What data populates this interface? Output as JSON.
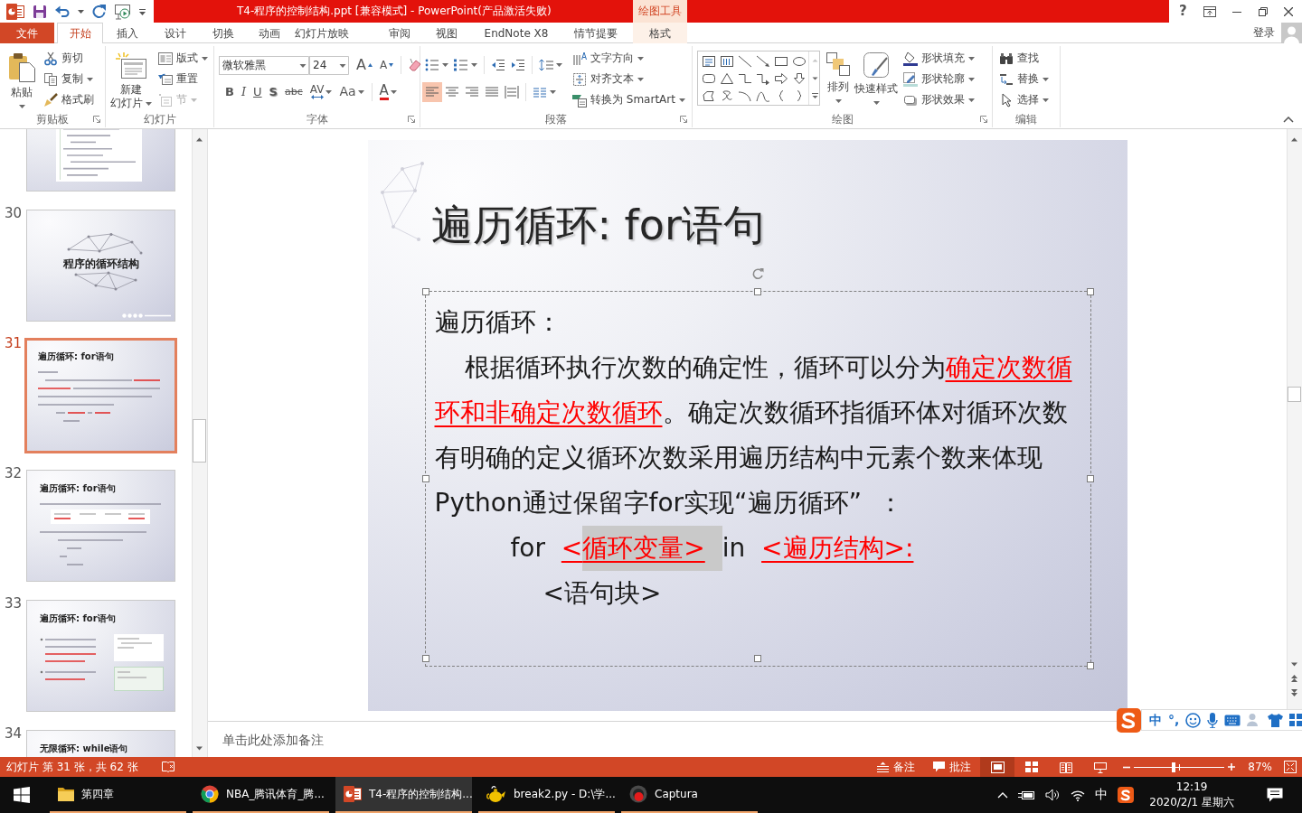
{
  "title_bar": {
    "title": "T4-程序的控制结构.ppt [兼容模式] - PowerPoint(产品激活失败)",
    "context_label": "绘图工具",
    "help": "?"
  },
  "tabs": [
    {
      "label": "文件",
      "kind": "file",
      "selected": false
    },
    {
      "label": "开始",
      "kind": "standard",
      "selected": true
    },
    {
      "label": "插入",
      "kind": "standard",
      "selected": false
    },
    {
      "label": "设计",
      "kind": "standard",
      "selected": false
    },
    {
      "label": "切换",
      "kind": "standard",
      "selected": false
    },
    {
      "label": "动画",
      "kind": "standard",
      "selected": false
    },
    {
      "label": "幻灯片放映",
      "kind": "standard",
      "selected": false
    },
    {
      "label": "审阅",
      "kind": "standard",
      "selected": false
    },
    {
      "label": "视图",
      "kind": "standard",
      "selected": false
    },
    {
      "label": "EndNote X8",
      "kind": "standard",
      "selected": false
    },
    {
      "label": "情节提要",
      "kind": "standard",
      "selected": false
    },
    {
      "label": "格式",
      "kind": "contextual",
      "selected": false
    }
  ],
  "account": {
    "sign_in": "登录"
  },
  "ribbon": {
    "clipboard": {
      "label": "剪贴板",
      "paste": {
        "label": "粘贴",
        "dropdown": true
      },
      "items": [
        {
          "label": "剪切",
          "dropdown": false
        },
        {
          "label": "复制",
          "dropdown": true
        },
        {
          "label": "格式刷",
          "dropdown": false
        }
      ]
    },
    "slides": {
      "label": "幻灯片",
      "new_slide": {
        "label_lines": [
          "新建",
          "幻灯片"
        ],
        "dropdown": true
      },
      "items": [
        {
          "label": "版式",
          "dropdown": true,
          "disabled": false
        },
        {
          "label": "重置",
          "dropdown": false,
          "disabled": false
        },
        {
          "label": "节",
          "dropdown": true,
          "disabled": true
        }
      ]
    },
    "font": {
      "label": "字体",
      "font_name": "微软雅黑",
      "font_size": "24",
      "size_buttons": [
        {
          "glyph": "A"
        },
        {
          "glyph": "A"
        }
      ],
      "format_buttons": [
        {
          "glyph": "B",
          "dropdown": false
        },
        {
          "glyph": "I",
          "dropdown": false
        },
        {
          "glyph": "U",
          "dropdown": false
        },
        {
          "glyph": "S",
          "dropdown": false
        },
        {
          "glyph": "abc",
          "dropdown": false
        },
        {
          "glyph": "AV",
          "dropdown": true
        },
        {
          "glyph": "Aa",
          "dropdown": true
        }
      ],
      "color_button": {
        "glyph": "A",
        "dropdown": true
      }
    },
    "paragraph": {
      "label": "段落",
      "align_buttons": [
        {
          "selected": true
        },
        {
          "selected": false
        },
        {
          "selected": false
        },
        {
          "selected": false
        },
        {
          "selected": false
        }
      ],
      "items": [
        {
          "label": "文字方向",
          "dropdown": true
        },
        {
          "label": "对齐文本",
          "dropdown": true
        },
        {
          "label": "转换为 SmartArt",
          "dropdown": true
        }
      ]
    },
    "drawing": {
      "label": "绘图",
      "arrange": {
        "label": "排列",
        "dropdown": true
      },
      "quick_styles": {
        "label": "快速样式",
        "dropdown": true
      },
      "items": [
        {
          "label": "形状填充",
          "dropdown": true
        },
        {
          "label": "形状轮廓",
          "dropdown": true
        },
        {
          "label": "形状效果",
          "dropdown": true
        }
      ]
    },
    "editing": {
      "label": "编辑",
      "items": [
        {
          "label": "查找",
          "dropdown": false
        },
        {
          "label": "替换",
          "dropdown": true
        },
        {
          "label": "选择",
          "dropdown": true
        }
      ]
    }
  },
  "thumbnails": [
    {
      "kind": "code",
      "selected": false
    },
    {
      "number": "30",
      "kind": "section",
      "title": "程序的循环结构",
      "selected": false
    },
    {
      "number": "31",
      "kind": "text",
      "title": "遍历循环: for语句",
      "selected": true
    },
    {
      "number": "32",
      "kind": "table",
      "title": "遍历循环: for语句",
      "selected": false
    },
    {
      "number": "33",
      "kind": "bullets",
      "title": "遍历循环: for语句",
      "selected": false
    },
    {
      "number": "34",
      "kind": "text",
      "title": "无限循环: while语句",
      "selected": false
    }
  ],
  "slide": {
    "title": "遍历循环: for语句",
    "paragraphs": [
      {
        "kind": "plain",
        "segments": [
          {
            "text": "遍历循环：",
            "emphasis": false
          }
        ]
      },
      {
        "kind": "indent",
        "segments": [
          {
            "text": "根据循环执行次数的确定性，循环可以分为",
            "emphasis": false
          },
          {
            "text": "确定次数循环和非确定次数循环",
            "emphasis": true
          },
          {
            "text": "。确定次数循环指循环体对循环次数有明确的定义循环次数采用遍历结构中元素个数来体现",
            "emphasis": false
          }
        ]
      },
      {
        "kind": "plain",
        "segments": [
          {
            "text": "Python通过保留字for实现“遍历循环”  ：",
            "emphasis": false
          }
        ]
      },
      {
        "kind": "code",
        "segments": [
          {
            "text": "for  ",
            "emphasis": false,
            "selected": false
          },
          {
            "text": "<",
            "emphasis": true,
            "selected": false
          },
          {
            "text": "循环变量>",
            "emphasis": true,
            "selected": true
          },
          {
            "text": "in  ",
            "emphasis": false,
            "selected": false
          },
          {
            "text": "<遍历结构>:",
            "emphasis": true,
            "selected": false
          }
        ]
      },
      {
        "kind": "block",
        "segments": [
          {
            "text": "<语句块>",
            "emphasis": false
          }
        ]
      }
    ]
  },
  "notes": {
    "placeholder": "单击此处添加备注"
  },
  "status_bar": {
    "slide_info": "幻灯片 第 31 张，共 62 张",
    "notes": "备注",
    "comments": "批注",
    "views": [
      {
        "selected": true
      },
      {
        "selected": false
      },
      {
        "selected": false
      },
      {
        "selected": false
      }
    ],
    "zoom": {
      "level": 0.44,
      "reading": "87%"
    }
  },
  "ime_toolbar": {
    "mode": "中",
    "punctuation": "°,"
  },
  "taskbar": {
    "apps": [
      {
        "label": "第四章",
        "kind": "folder",
        "selected": false
      },
      {
        "label": "NBA_腾讯体育_腾...",
        "kind": "browser",
        "selected": false
      },
      {
        "label": "T4-程序的控制结构...",
        "kind": "presentation",
        "selected": true
      },
      {
        "label": "break2.py - D:\\学...",
        "kind": "editor",
        "selected": false
      },
      {
        "label": "Captura",
        "kind": "recorder",
        "selected": false
      }
    ],
    "tray": {
      "input_mode": "中",
      "time": "12:19",
      "date": "2020/2/1 星期六"
    }
  }
}
